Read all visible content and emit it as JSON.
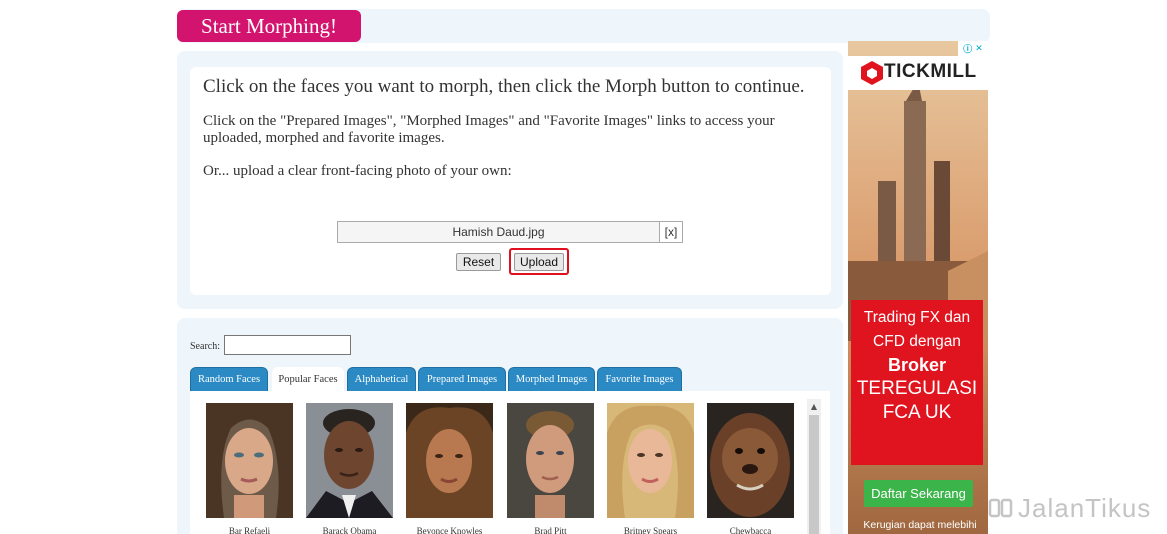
{
  "header": {
    "title": "Start Morphing!"
  },
  "instructions": {
    "title": "Click on the faces you want to morph, then click the Morph button to continue.",
    "paragraph1": "Click on the \"Prepared Images\", \"Morphed Images\" and \"Favorite Images\" links to access your uploaded, morphed and favorite images.",
    "paragraph2": "Or... upload a clear front-facing photo of your own:"
  },
  "upload": {
    "file_name": "Hamish Daud.jpg",
    "clear_label": "[x]",
    "reset_label": "Reset",
    "upload_label": "Upload"
  },
  "search": {
    "label": "Search:",
    "value": ""
  },
  "tabs": [
    {
      "label": "Random Faces",
      "active": false
    },
    {
      "label": "Popular Faces",
      "active": true
    },
    {
      "label": "Alphabetical",
      "active": false
    },
    {
      "label": "Prepared Images",
      "active": false
    },
    {
      "label": "Morphed Images",
      "active": false
    },
    {
      "label": "Favorite Images",
      "active": false
    }
  ],
  "faces": [
    {
      "name": "Bar Refaeli"
    },
    {
      "name": "Barack Obama"
    },
    {
      "name": "Beyonce Knowles"
    },
    {
      "name": "Brad Pitt"
    },
    {
      "name": "Britney Spears"
    },
    {
      "name": "Chewbacca"
    }
  ],
  "ad": {
    "brand": "TICKMILL",
    "line1": "Trading FX dan",
    "line2": "CFD dengan",
    "line3": "Broker",
    "line4": "TEREGULASI",
    "line5": "FCA UK",
    "cta": "Daftar Sekarang",
    "disclaimer": "Kerugian dapat melebihi"
  },
  "watermark": {
    "text": "JalanTikus"
  },
  "colors": {
    "accent": "#d2146f",
    "tab_blue": "#2b8ac4",
    "highlight": "#e0101e",
    "ad_red": "#e0141e",
    "cta_green": "#3bb54a"
  }
}
